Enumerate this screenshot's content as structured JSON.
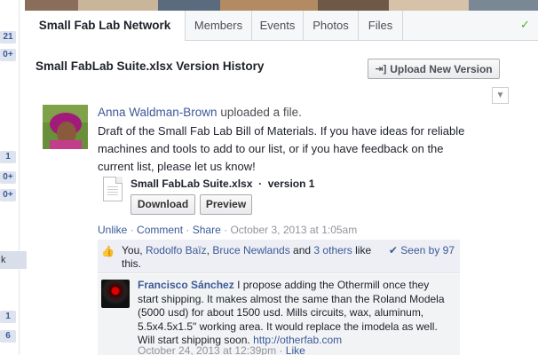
{
  "left_rail": {
    "badges": [
      "21",
      "0+",
      "1",
      "0+",
      "0+",
      "1",
      "6"
    ],
    "selected_item": "k"
  },
  "tabs": [
    {
      "label": "Small Fab Lab Network",
      "active": true
    },
    {
      "label": "Members",
      "active": false
    },
    {
      "label": "Events",
      "active": false
    },
    {
      "label": "Photos",
      "active": false
    },
    {
      "label": "Files",
      "active": false
    }
  ],
  "header": {
    "title": "Small FabLab Suite.xlsx Version History",
    "upload_button": "Upload New Version"
  },
  "post": {
    "author": "Anna Waldman-Brown",
    "action_text": "uploaded a file.",
    "body": "Draft of the Small Fab Lab Bill of Materials. If you have ideas for reliable machines and tools to add to our list, or if you have feedback on the current list, please let us know!",
    "file_name": "Small FabLab Suite.xlsx",
    "file_version": "version 1",
    "download_label": "Download",
    "preview_label": "Preview",
    "actions": {
      "unlike": "Unlike",
      "comment": "Comment",
      "share": "Share",
      "timestamp": "October 3, 2013 at 1:05am"
    },
    "likes": {
      "you": "You,",
      "user1": "Rodolfo Baïz",
      "user2": "Bruce Newlands",
      "and": "and",
      "others": "3 others",
      "suffix": "like this.",
      "seen": "Seen by 97"
    }
  },
  "comment": {
    "author": "Francisco Sánchez",
    "text": "I propose adding the Othermill once they start shipping. It makes almost the same than the Roland Modela (5000 usd) for about 1500 usd. Mills circuits, wax, aluminum, 5.5x4.5x1.5\" working area. It would replace the imodela as well. Will start shipping soon.",
    "link": "http://otherfab.com",
    "timestamp": "October 24, 2013 at 12:39pm",
    "like_label": "Like"
  },
  "colors": {
    "link": "#3b5998",
    "tab_bar": "#f6f7f9",
    "likes_bg": "#edeff4",
    "check": "#42b72a"
  }
}
